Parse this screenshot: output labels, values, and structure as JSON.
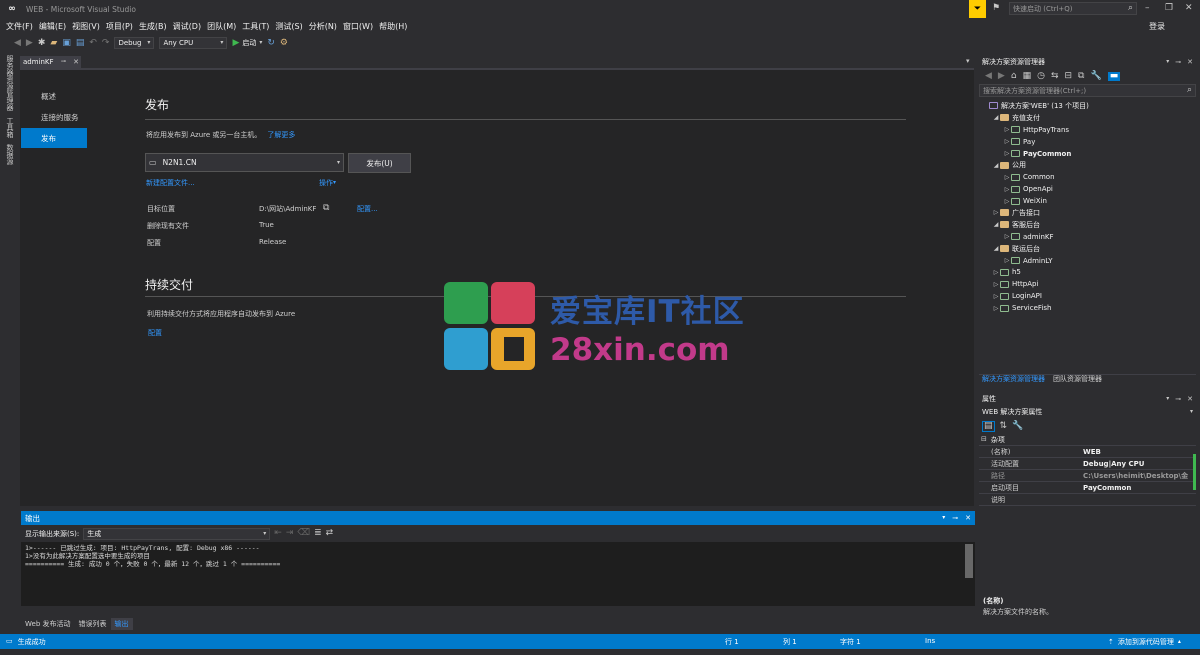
{
  "window": {
    "title": "WEB - Microsoft Visual Studio",
    "quick_launch_placeholder": "快速启动 (Ctrl+Q)",
    "login": "登录"
  },
  "menu": [
    "文件(F)",
    "编辑(E)",
    "视图(V)",
    "项目(P)",
    "生成(B)",
    "调试(D)",
    "团队(M)",
    "工具(T)",
    "测试(S)",
    "分析(N)",
    "窗口(W)",
    "帮助(H)"
  ],
  "toolbar": {
    "config": "Debug",
    "platform": "Any CPU",
    "start_label": "启动"
  },
  "left_strip": [
    "服务器资源管理器",
    "工具箱",
    "数据源"
  ],
  "doc_tab": {
    "label": "adminKF"
  },
  "publish": {
    "nav": [
      "概述",
      "连接的服务",
      "发布"
    ],
    "title": "发布",
    "intro": "将应用发布到 Azure 或另一台主机。",
    "learn_more": "了解更多",
    "profile": "N2N1.CN",
    "publish_button": "发布(U)",
    "new_profile": "新建配置文件...",
    "actions": "操作",
    "details": [
      {
        "label": "目标位置",
        "value": "D:\\网站\\AdminKF"
      },
      {
        "label": "删除现有文件",
        "value": "True"
      },
      {
        "label": "配置",
        "value": "Release"
      }
    ],
    "configure": "配置...",
    "cd_title": "持续交付",
    "cd_intro": "利用持续交付方式将应用程序自动发布到 Azure",
    "cd_configure": "配置"
  },
  "watermark": {
    "line1": "爱宝库IT社区",
    "line2": "28xin.com"
  },
  "output": {
    "title": "输出",
    "source_label": "显示输出来源(S):",
    "source_value": "生成",
    "lines": [
      "1>------ 已跳过生成: 项目: HttpPayTrans, 配置: Debug x86 ------",
      "1>没有为此解决方案配置选中要生成的项目",
      "========== 生成: 成功 0 个，失败 0 个，最新 12 个，跳过 1 个 =========="
    ]
  },
  "bottom_tabs": [
    "Web 发布活动",
    "错误列表",
    "输出"
  ],
  "status": {
    "message": "生成成功",
    "line": "行 1",
    "col": "列 1",
    "char": "字符 1",
    "mode": "Ins",
    "source_control": "添加到源代码管理"
  },
  "solution_explorer": {
    "title": "解决方案资源管理器",
    "search_placeholder": "搜索解决方案资源管理器(Ctrl+;)",
    "tree": [
      {
        "label": "解决方案'WEB' (13 个项目)",
        "type": "sln",
        "exp": ""
      },
      {
        "label": "充值支付",
        "type": "folder",
        "exp": "◢"
      },
      {
        "label": "HttpPayTrans",
        "type": "proj",
        "exp": "▷"
      },
      {
        "label": "Pay",
        "type": "proj",
        "exp": "▷"
      },
      {
        "label": "PayCommon",
        "type": "proj",
        "exp": "▷"
      },
      {
        "label": "公用",
        "type": "folder",
        "exp": "◢"
      },
      {
        "label": "Common",
        "type": "proj",
        "exp": "▷"
      },
      {
        "label": "OpenApi",
        "type": "proj",
        "exp": "▷"
      },
      {
        "label": "WeiXin",
        "type": "proj",
        "exp": "▷"
      },
      {
        "label": "广告接口",
        "type": "folder",
        "exp": "▷"
      },
      {
        "label": "客服后台",
        "type": "folder",
        "exp": "◢"
      },
      {
        "label": "adminKF",
        "type": "proj",
        "exp": "▷"
      },
      {
        "label": "联运后台",
        "type": "folder",
        "exp": "◢"
      },
      {
        "label": "AdminLY",
        "type": "proj",
        "exp": "▷"
      },
      {
        "label": "h5",
        "type": "proj",
        "exp": "▷"
      },
      {
        "label": "HttpApi",
        "type": "proj",
        "exp": "▷"
      },
      {
        "label": "LoginAPI",
        "type": "proj",
        "exp": "▷"
      },
      {
        "label": "ServiceFish",
        "type": "proj",
        "exp": "▷"
      }
    ],
    "tabs": [
      "解决方案资源管理器",
      "团队资源管理器"
    ]
  },
  "properties": {
    "title": "属性",
    "object": "WEB 解决方案属性",
    "category": "杂项",
    "rows": [
      {
        "name": "(名称)",
        "value": "WEB"
      },
      {
        "name": "活动配置",
        "value": "Debug|Any CPU"
      },
      {
        "name": "路径",
        "value": "C:\\Users\\heimit\\Desktop\\金"
      },
      {
        "name": "启动项目",
        "value": "PayCommon"
      },
      {
        "name": "说明",
        "value": ""
      }
    ],
    "desc_title": "(名称)",
    "desc_text": "解决方案文件的名称。"
  }
}
